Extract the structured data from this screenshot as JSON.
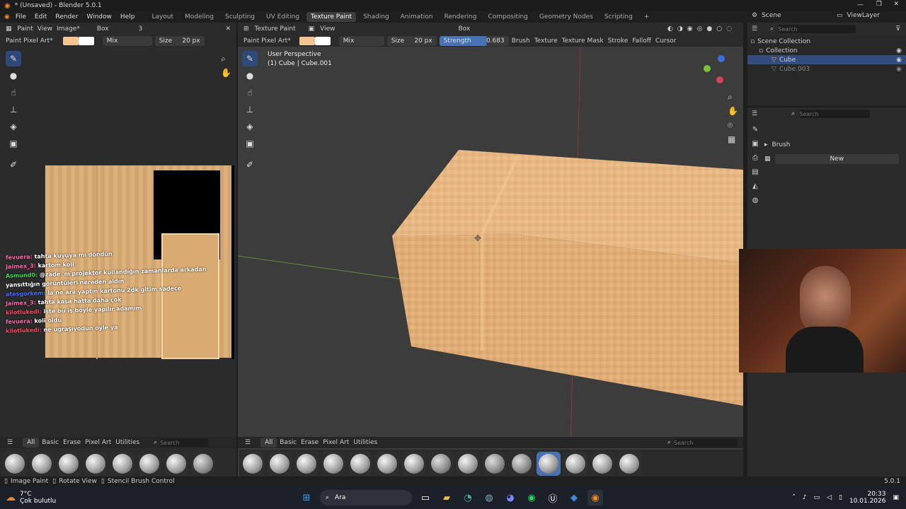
{
  "window": {
    "title": "* (Unsaved) - Blender 5.0.1"
  },
  "menu": [
    "File",
    "Edit",
    "Render",
    "Window",
    "Help"
  ],
  "workspaces": [
    "Layout",
    "Modeling",
    "Sculpting",
    "UV Editing",
    "Texture Paint",
    "Shading",
    "Animation",
    "Rendering",
    "Compositing",
    "Geometry Nodes",
    "Scripting"
  ],
  "active_workspace": "Texture Paint",
  "scene": {
    "name": "Scene",
    "view_layer": "ViewLayer"
  },
  "image_editor": {
    "mode": "Paint",
    "view": "View",
    "image": "Image*",
    "projection": "Box",
    "users": "3",
    "tool_name": "Paint Pixel Art*",
    "blend": "Mix",
    "size_label": "Size",
    "size_value": "20 px",
    "brush_tabs": [
      "All",
      "Basic",
      "Erase",
      "Pixel Art",
      "Utilities"
    ],
    "search_placeholder": "Search"
  },
  "viewport": {
    "mode": "Texture Paint",
    "view": "View",
    "projection": "Box",
    "tool_name": "Paint Pixel Art*",
    "blend": "Mix",
    "size_label": "Size",
    "size_value": "20 px",
    "strength_label": "Strength",
    "strength_value": "0.683",
    "strength": 0.683,
    "menus": [
      "Brush",
      "Texture",
      "Texture Mask",
      "Stroke",
      "Falloff",
      "Cursor"
    ],
    "overlay_line1": "User Perspective",
    "overlay_line2": "(1) Cube | Cube.001",
    "brush_tabs": [
      "All",
      "Basic",
      "Erase",
      "Pixel Art",
      "Utilities"
    ],
    "search_placeholder": "Search"
  },
  "outliner": {
    "search_placeholder": "Search",
    "root": "Scene Collection",
    "collection": "Collection",
    "items": [
      "Cube",
      "Cube.003"
    ]
  },
  "properties": {
    "search_placeholder": "Search",
    "section": "Brush",
    "new_label": "New"
  },
  "statusbar": {
    "hints": [
      "Image Paint",
      "Rotate View",
      "Stencil Brush Control"
    ],
    "version": "5.0.1"
  },
  "chat": [
    {
      "user": "Asmund0:",
      "text": "@zade 'm projektor kullandığın zamanlarda arkadan",
      "color": "#3dd94a"
    },
    {
      "user": "",
      "text": "yansıttığın görüntüleri nereden aldın",
      "color": "#ffffff"
    },
    {
      "user": "fevuera:",
      "text": "tahta kuyuya mı döndün",
      "color": "#ff66aa"
    },
    {
      "user": "Jaimex_3:",
      "text": "kartom koli",
      "color": "#ff66aa"
    },
    {
      "user": "atesgorkem:",
      "text": "la ne ara yaptın kartonu 2dk gitim sadece",
      "color": "#4a6cff"
    },
    {
      "user": "Jaimex_3:",
      "text": "tahta kasa hatta daha çok",
      "color": "#ff66aa"
    },
    {
      "user": "kilotlukedi:",
      "text": "işte bu iş böyle yapılır adamım",
      "color": "#ff4466"
    },
    {
      "user": "fevuera:",
      "text": "koli oldu",
      "color": "#ff66aa"
    },
    {
      "user": "kilotlukedi:",
      "text": "ne uğraşıyodun öyle ya",
      "color": "#ff4466"
    }
  ],
  "taskbar": {
    "weather_temp": "7°C",
    "weather_desc": "Çok bulutlu",
    "search_label": "Ara",
    "time": "20:33",
    "date": "10.01.2026"
  },
  "colors": {
    "accent": "#4772b3",
    "primary_color": "#f5c490",
    "secondary_color": "#ffffff",
    "active_tab": "#3d3d3d"
  }
}
